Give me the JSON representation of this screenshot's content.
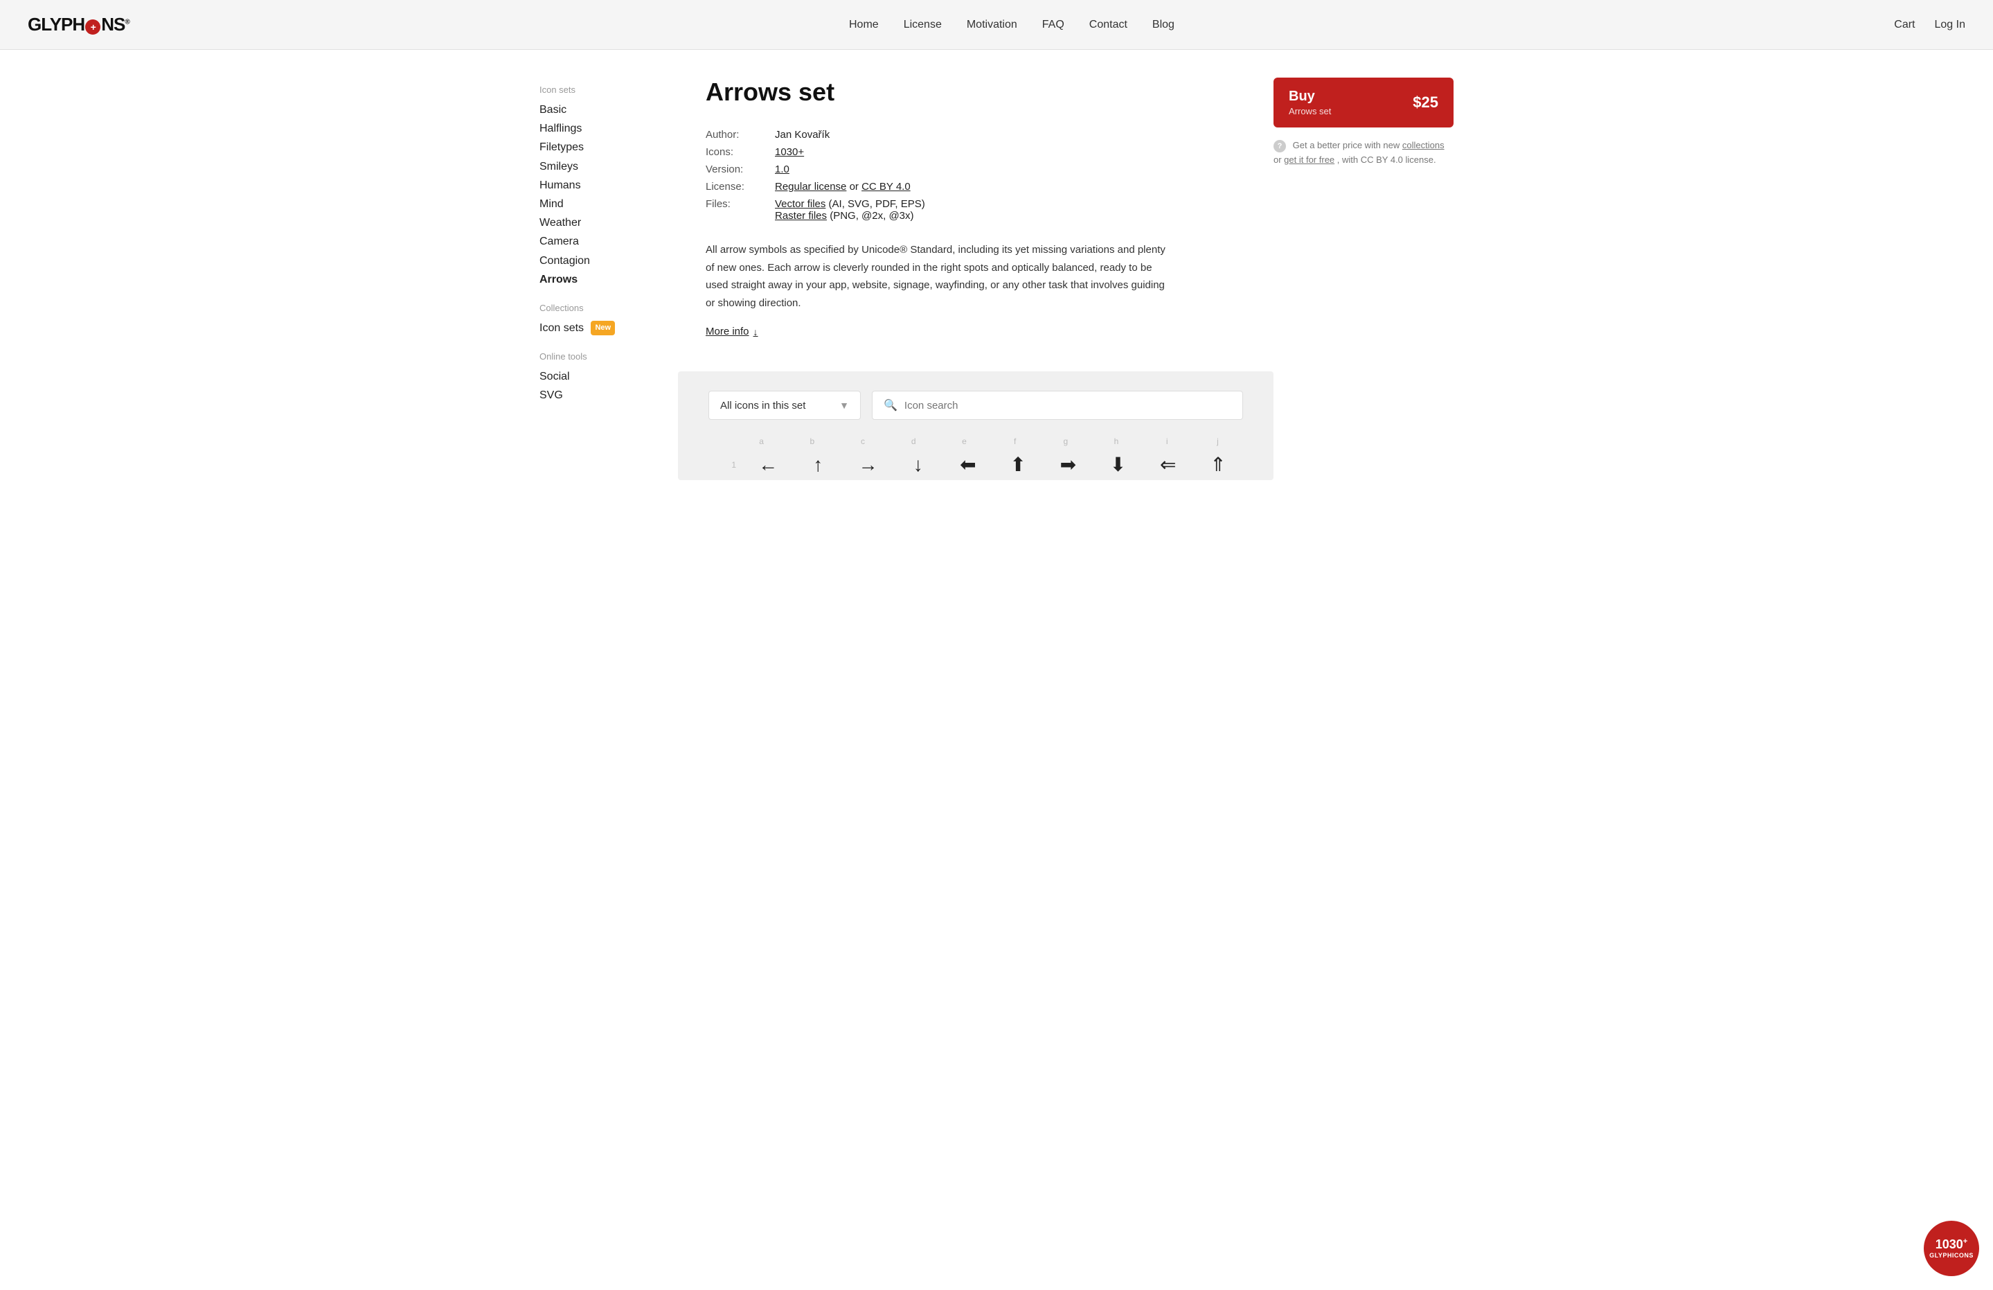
{
  "header": {
    "logo_text": "GLYPHICONS",
    "logo_icon": "+",
    "nav": [
      {
        "label": "Home",
        "href": "#"
      },
      {
        "label": "License",
        "href": "#"
      },
      {
        "label": "Motivation",
        "href": "#"
      },
      {
        "label": "FAQ",
        "href": "#"
      },
      {
        "label": "Contact",
        "href": "#"
      },
      {
        "label": "Blog",
        "href": "#"
      }
    ],
    "nav_right": [
      {
        "label": "Cart",
        "href": "#"
      },
      {
        "label": "Log In",
        "href": "#"
      }
    ]
  },
  "sidebar": {
    "sections": [
      {
        "label": "Icon sets",
        "items": [
          {
            "label": "Basic",
            "active": false
          },
          {
            "label": "Halflings",
            "active": false
          },
          {
            "label": "Filetypes",
            "active": false
          },
          {
            "label": "Smileys",
            "active": false
          },
          {
            "label": "Humans",
            "active": false
          },
          {
            "label": "Mind",
            "active": false
          },
          {
            "label": "Weather",
            "active": false
          },
          {
            "label": "Camera",
            "active": false
          },
          {
            "label": "Contagion",
            "active": false
          },
          {
            "label": "Arrows",
            "active": true
          }
        ]
      },
      {
        "label": "Collections",
        "items": [
          {
            "label": "Icon sets",
            "active": false,
            "badge": "New"
          }
        ]
      },
      {
        "label": "Online tools",
        "items": [
          {
            "label": "Social",
            "active": false
          },
          {
            "label": "SVG",
            "active": false
          }
        ]
      }
    ]
  },
  "main": {
    "title": "Arrows set",
    "meta": [
      {
        "label": "Author:",
        "value": "Jan Kovařík",
        "link": false
      },
      {
        "label": "Icons:",
        "value": "1030+",
        "link": true
      },
      {
        "label": "Version:",
        "value": "1.0",
        "link": true
      },
      {
        "label": "License:",
        "value": "Regular license or CC BY 4.0",
        "link": true
      },
      {
        "label": "Files:",
        "value_parts": [
          {
            "text": "Vector files",
            "link": true
          },
          {
            "text": " (AI, SVG, PDF, EPS)",
            "link": false
          },
          {
            "text": "\nRaster files",
            "link": true,
            "newline": true
          },
          {
            "text": " (PNG, @2x, @3x)",
            "link": false
          }
        ]
      }
    ],
    "description": "All arrow symbols as specified by Unicode® Standard, including its yet missing variations and plenty of new ones. Each arrow is cleverly rounded in the right spots and optically balanced, ready to be used straight away in your app, website, signage, wayfinding, or any other task that involves guiding or showing direction.",
    "more_info_label": "More info"
  },
  "buy": {
    "button_label": "Buy",
    "button_subtitle": "Arrows set",
    "price": "$25",
    "info_text": "Get a better price with new",
    "collections_link": "collections",
    "or_text": "or",
    "free_link": "get it for free",
    "cc_text": ", with CC BY 4.0 license."
  },
  "icon_browser": {
    "filter_label": "All icons in this set",
    "search_placeholder": "Icon search",
    "alpha_row": [
      "a",
      "b",
      "c",
      "d",
      "e",
      "f",
      "g",
      "h",
      "i",
      "j"
    ],
    "icon_rows": [
      {
        "row_number": "1",
        "icons": [
          "←",
          "↑",
          "→",
          "↓",
          "←",
          "↑",
          "→",
          "↓",
          "←",
          "↑"
        ]
      }
    ]
  },
  "corner_badge": {
    "number": "1030",
    "plus": "+",
    "label": "GLYPHICONS"
  }
}
